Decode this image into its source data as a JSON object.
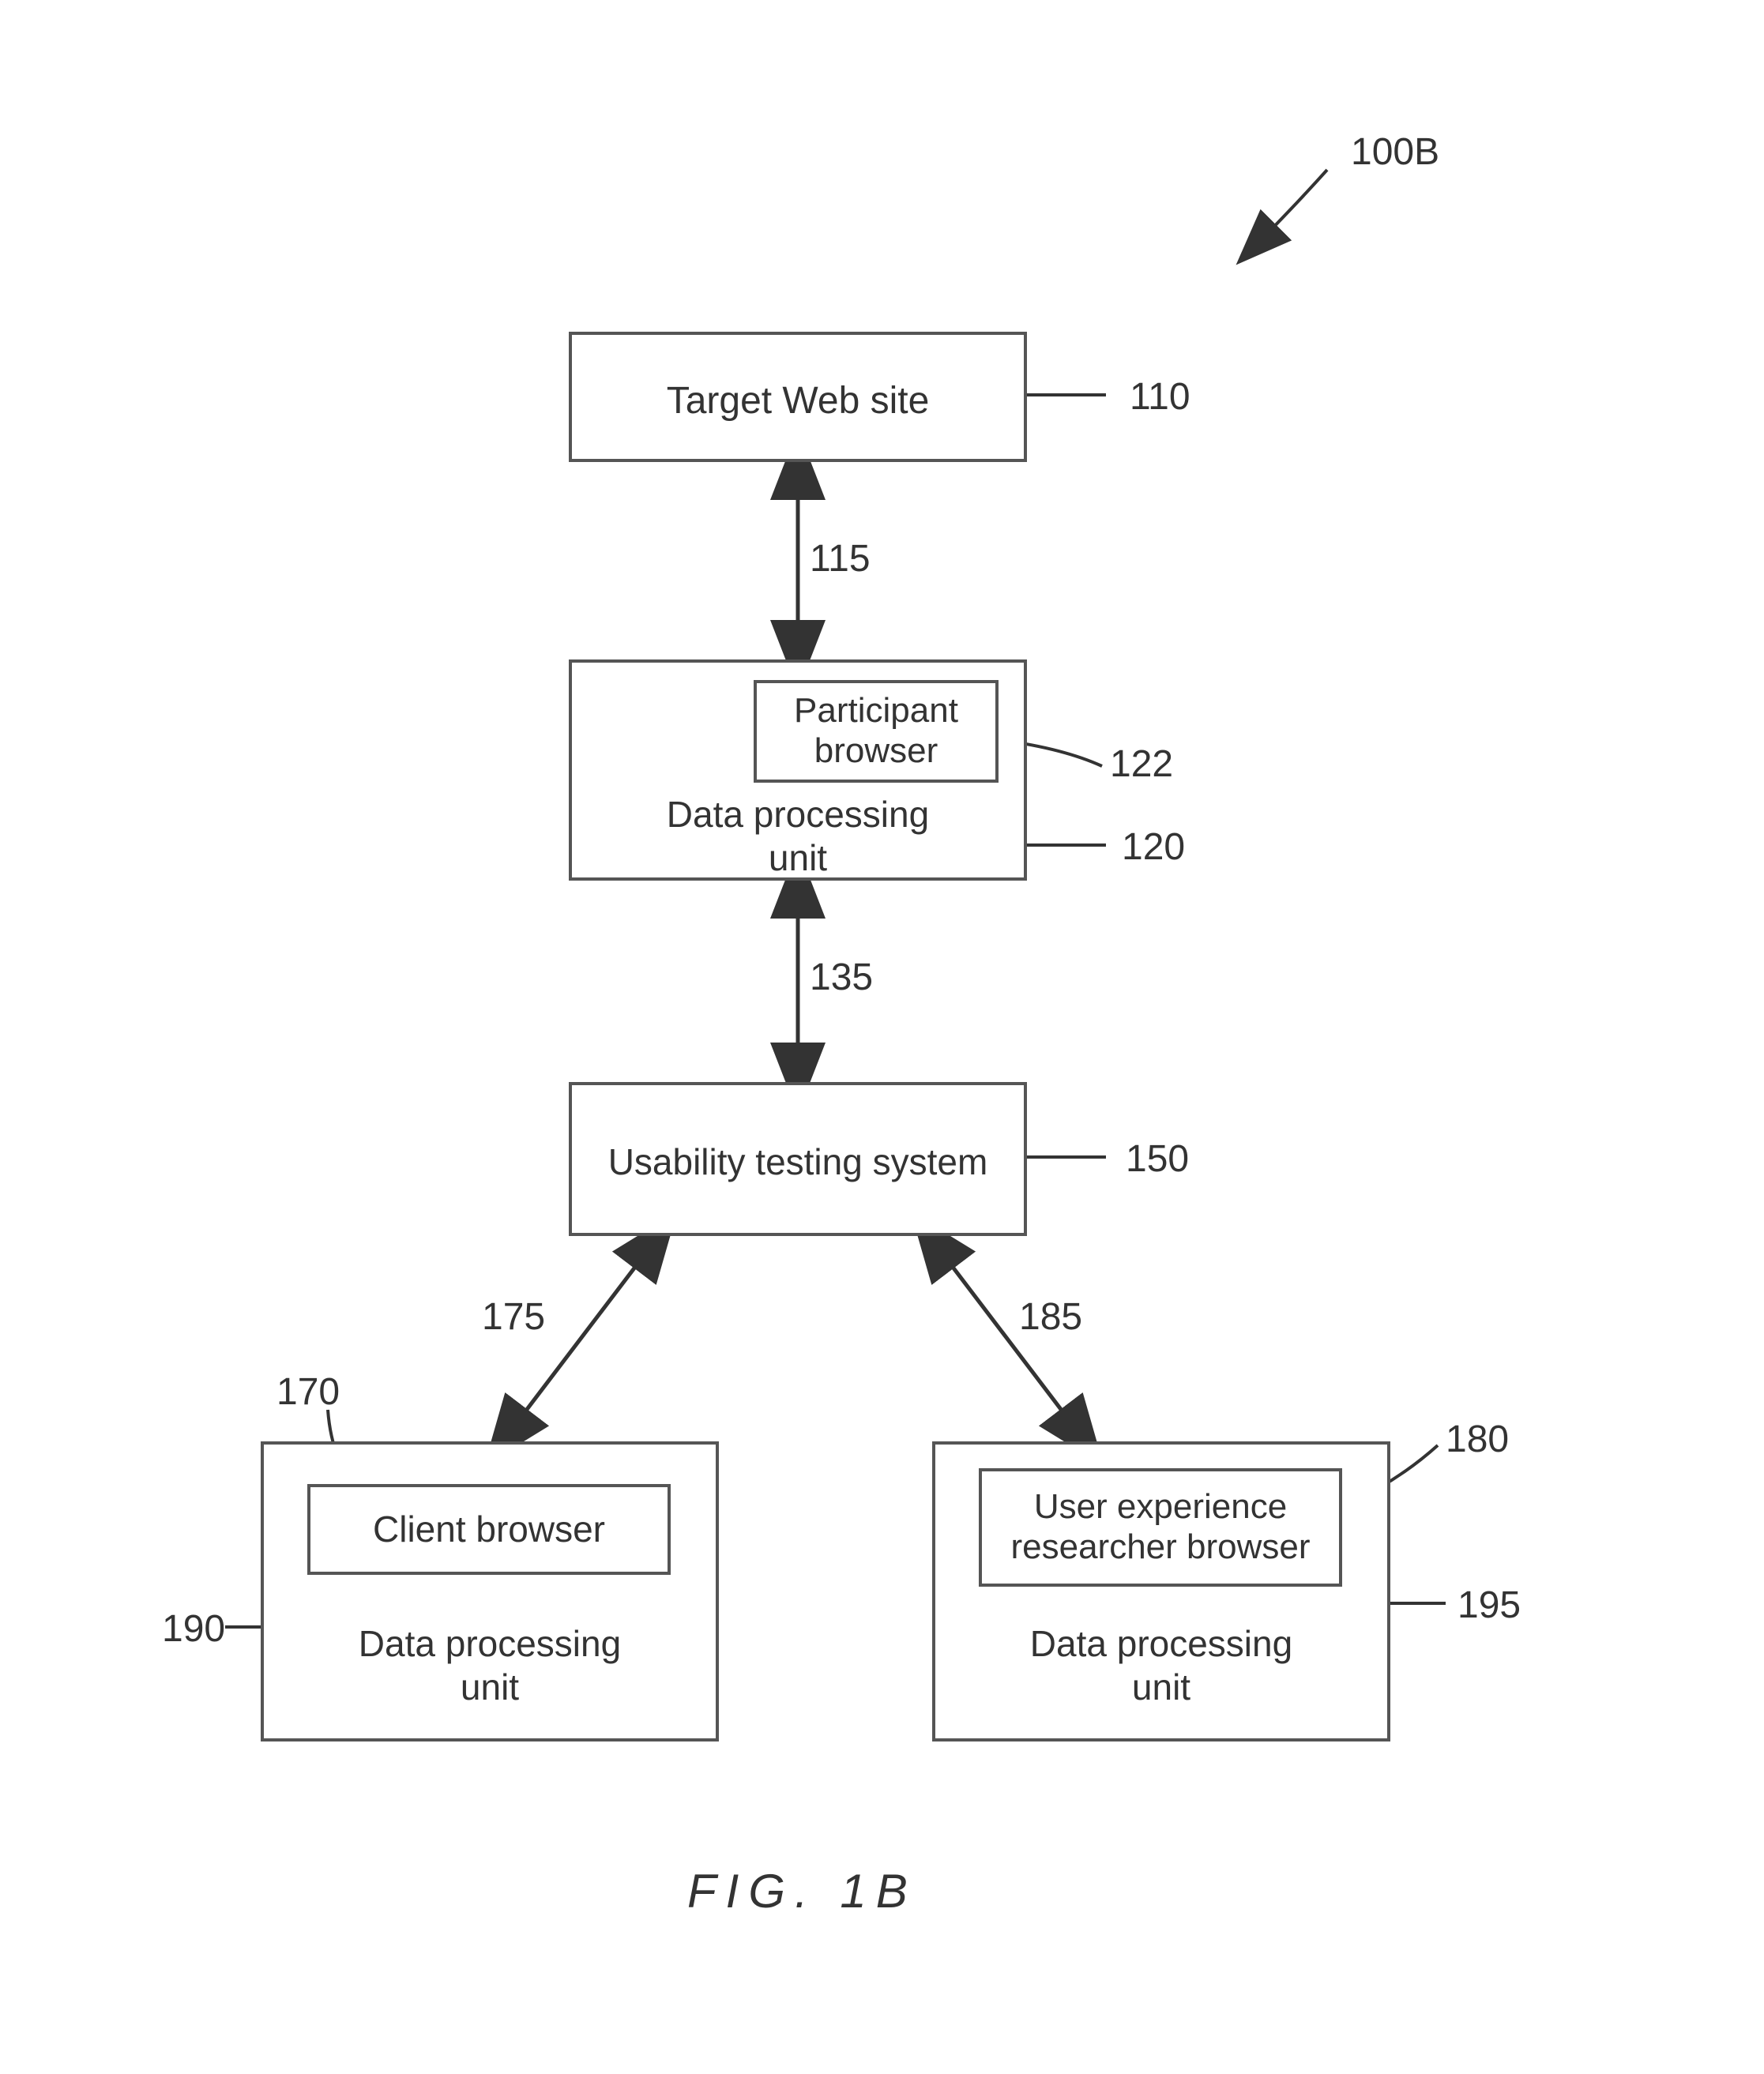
{
  "figure": {
    "overall_ref": "100B",
    "caption": "FIG. 1B"
  },
  "boxes": {
    "target": {
      "label": "Target Web site",
      "ref": "110"
    },
    "participant_dpu": {
      "label": "Data processing\nunit",
      "ref": "120"
    },
    "participant_browser": {
      "label": "Participant\nbrowser",
      "ref": "122"
    },
    "usability": {
      "label": "Usability testing system",
      "ref": "150"
    },
    "client_dpu": {
      "label": "Data processing\nunit",
      "ref": "190"
    },
    "client_browser": {
      "label": "Client browser",
      "ref": "170"
    },
    "ux_dpu": {
      "label": "Data processing\nunit",
      "ref": "195"
    },
    "ux_browser": {
      "label": "User experience\nresearcher browser",
      "ref": "180"
    }
  },
  "connections": {
    "target_participant": "115",
    "participant_usability": "135",
    "usability_client": "175",
    "usability_ux": "185"
  }
}
